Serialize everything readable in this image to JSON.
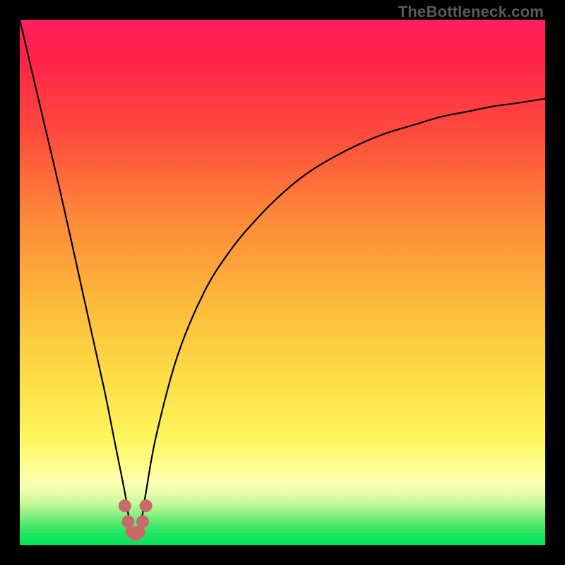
{
  "watermark": "TheBottleneck.com",
  "colors": {
    "black": "#000000",
    "curve": "#000000",
    "marker": "#c96a6a",
    "green": "#00e559",
    "green_mid": "#2ee66a",
    "yellow_pale": "#fef99a",
    "yellow": "#fcd63f",
    "orange": "#fd9a3a",
    "red_orange": "#ff5938",
    "red": "#ff2445",
    "magenta": "#ff1f5e"
  },
  "chart_data": {
    "type": "line",
    "title": "",
    "xlabel": "",
    "ylabel": "",
    "xlim": [
      0,
      100
    ],
    "ylim": [
      0,
      100
    ],
    "notes": "V-shaped bottleneck curve on rainbow gradient; y represents bottleneck percentage (0 = no bottleneck / green, 100 = severe / red). Minimum near x≈22.",
    "series": [
      {
        "name": "bottleneck-curve",
        "x": [
          0,
          4,
          8,
          12,
          16,
          18,
          20,
          21,
          22,
          23,
          24,
          26,
          30,
          35,
          40,
          45,
          50,
          55,
          60,
          65,
          70,
          75,
          80,
          85,
          90,
          95,
          100
        ],
        "y": [
          100,
          83,
          66,
          48,
          30,
          20,
          10,
          4,
          2,
          4,
          10,
          21,
          36,
          48,
          56,
          62,
          67,
          71,
          74,
          76.5,
          78.5,
          80,
          81.5,
          82.5,
          83.5,
          84.2,
          85
        ]
      }
    ],
    "markers": {
      "name": "highlight-dots",
      "x": [
        20.0,
        20.6,
        21.3,
        22.0,
        22.7,
        23.4,
        24.0
      ],
      "y": [
        7.5,
        4.5,
        2.5,
        2.0,
        2.5,
        4.5,
        7.5
      ]
    },
    "gradient_stops": [
      {
        "pos": 0.0,
        "meaning": "top (severe bottleneck)"
      },
      {
        "pos": 1.0,
        "meaning": "bottom (optimal / no bottleneck)"
      }
    ]
  }
}
